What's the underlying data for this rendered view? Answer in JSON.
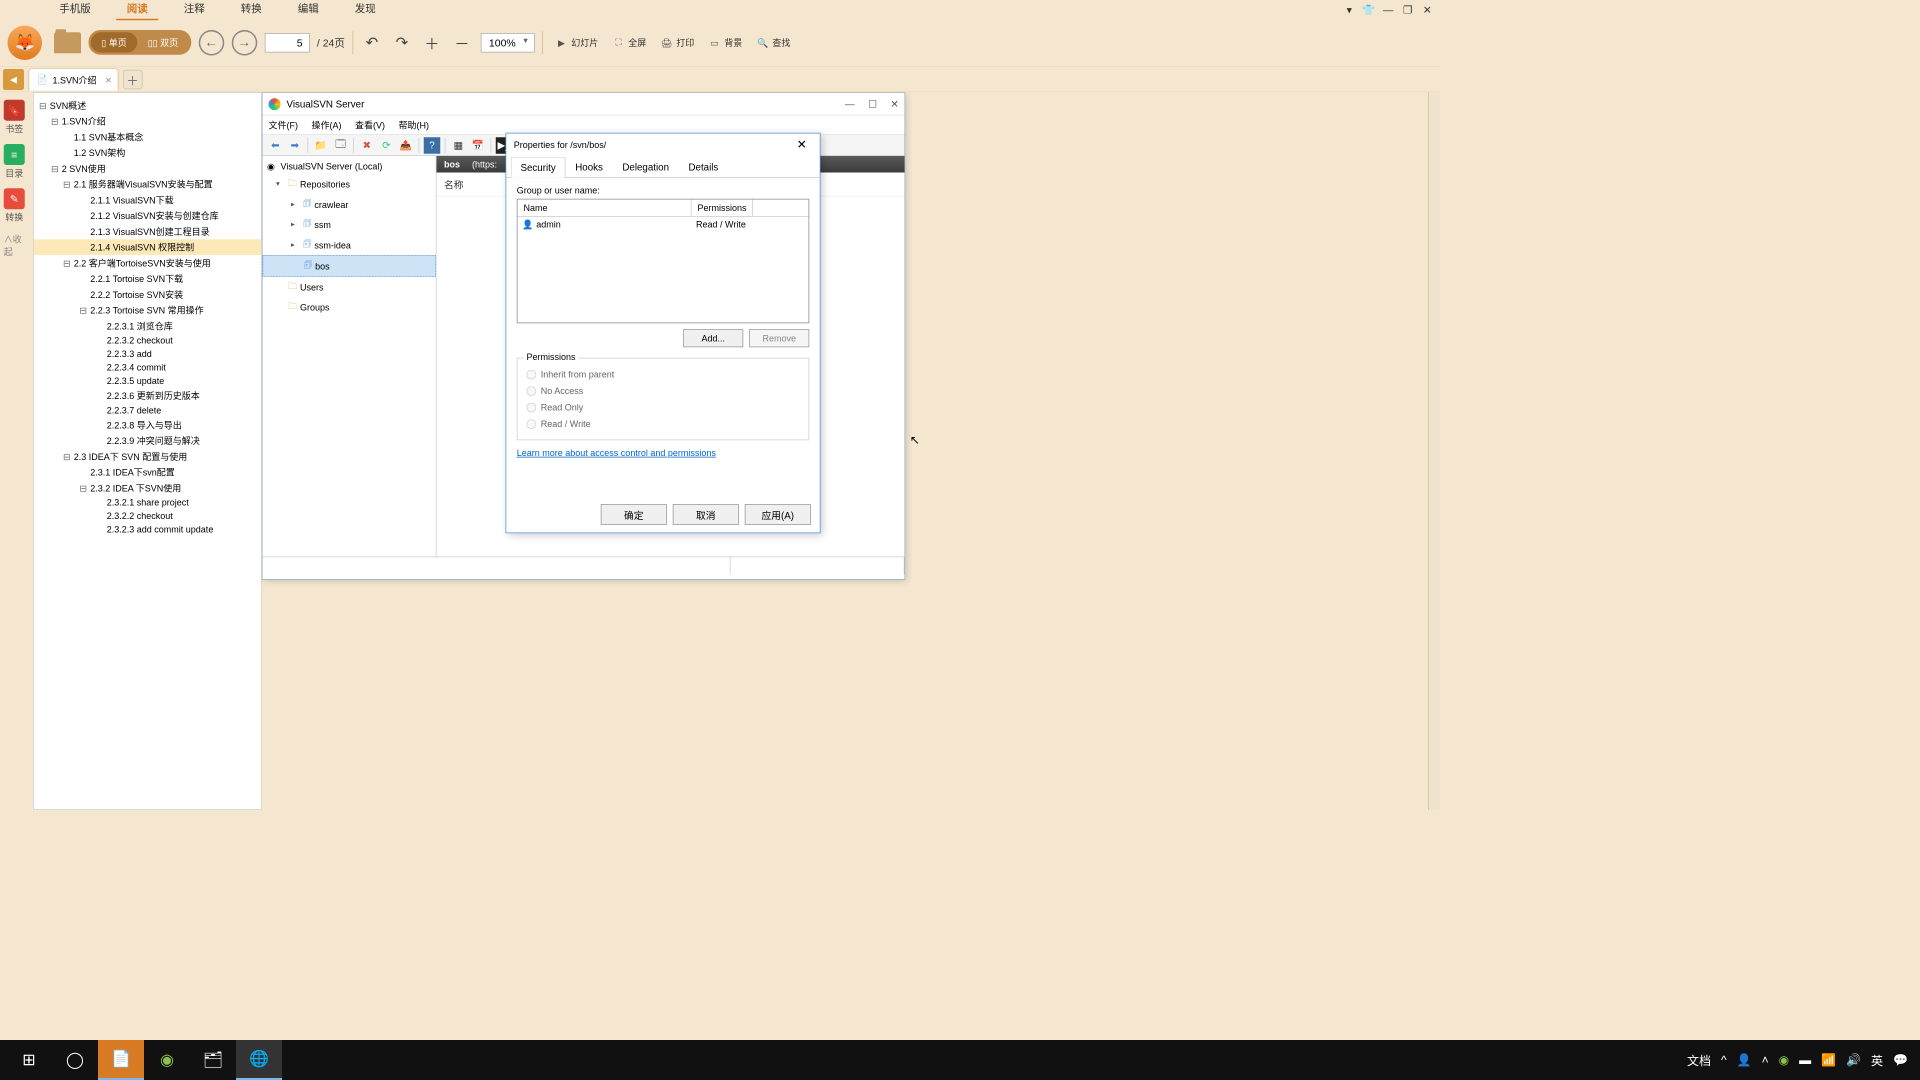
{
  "topTabs": [
    "手机版",
    "阅读",
    "注释",
    "转换",
    "编辑",
    "发现"
  ],
  "activeTopTab": 1,
  "toolbar": {
    "singlePage": "单页",
    "doublePage": "双页",
    "pageCurrent": "5",
    "pageTotal": "/ 24页",
    "zoom": "100%",
    "items": [
      {
        "ic": "▶",
        "t": "幻灯片"
      },
      {
        "ic": "⛶",
        "t": "全屏"
      },
      {
        "ic": "🖨",
        "t": "打印"
      },
      {
        "ic": "▭",
        "t": "背景"
      },
      {
        "ic": "🔍",
        "t": "查找"
      }
    ]
  },
  "docTab": {
    "title": "1.SVN介绍"
  },
  "sidebar": [
    {
      "cls": "red",
      "ic": "🔖",
      "t": "书签"
    },
    {
      "cls": "green",
      "ic": "≡",
      "t": "目录"
    },
    {
      "cls": "blue",
      "ic": "✎",
      "t": "转换"
    }
  ],
  "outline": [
    {
      "i": 0,
      "e": "⊟",
      "t": "SVN概述"
    },
    {
      "i": 1,
      "e": "⊟",
      "t": "1.SVN介绍"
    },
    {
      "i": 2,
      "e": "",
      "t": "1.1 SVN基本概念"
    },
    {
      "i": 2,
      "e": "",
      "t": "1.2 SVN架构"
    },
    {
      "i": 1,
      "e": "⊟",
      "t": "2 SVN使用"
    },
    {
      "i": 2,
      "e": "⊟",
      "t": "2.1 服务器端VisualSVN安装与配置"
    },
    {
      "i": 3,
      "e": "",
      "t": "2.1.1 VisualSVN下载"
    },
    {
      "i": 3,
      "e": "",
      "t": "2.1.2 VisualSVN安装与创建仓库"
    },
    {
      "i": 3,
      "e": "",
      "t": "2.1.3 VisualSVN创建工程目录"
    },
    {
      "i": 3,
      "e": "",
      "t": "2.1.4 VisualSVN 权限控制",
      "hl": true
    },
    {
      "i": 2,
      "e": "⊟",
      "t": "2.2 客户端TortoiseSVN安装与使用"
    },
    {
      "i": 3,
      "e": "",
      "t": "2.2.1 Tortoise SVN下载"
    },
    {
      "i": 3,
      "e": "",
      "t": "2.2.2 Tortoise SVN安装"
    },
    {
      "i": 3,
      "e": "⊟",
      "t": "2.2.3 Tortoise SVN 常用操作"
    },
    {
      "i": 4,
      "e": "",
      "t": "2.2.3.1 浏览仓库"
    },
    {
      "i": 4,
      "e": "",
      "t": "2.2.3.2 checkout"
    },
    {
      "i": 4,
      "e": "",
      "t": "2.2.3.3 add"
    },
    {
      "i": 4,
      "e": "",
      "t": "2.2.3.4 commit"
    },
    {
      "i": 4,
      "e": "",
      "t": "2.2.3.5 update"
    },
    {
      "i": 4,
      "e": "",
      "t": "2.2.3.6 更新到历史版本"
    },
    {
      "i": 4,
      "e": "",
      "t": "2.2.3.7 delete"
    },
    {
      "i": 4,
      "e": "",
      "t": "2.2.3.8 导入与导出"
    },
    {
      "i": 4,
      "e": "",
      "t": "2.2.3.9 冲突问题与解决"
    },
    {
      "i": 2,
      "e": "⊟",
      "t": "2.3 IDEA下 SVN 配置与使用"
    },
    {
      "i": 3,
      "e": "",
      "t": "2.3.1 IDEA下svn配置"
    },
    {
      "i": 3,
      "e": "⊟",
      "t": "2.3.2 IDEA 下SVN使用"
    },
    {
      "i": 4,
      "e": "",
      "t": "2.3.2.1 share project"
    },
    {
      "i": 4,
      "e": "",
      "t": "2.3.2.2 checkout"
    },
    {
      "i": 4,
      "e": "",
      "t": "2.3.2.3 add commit update"
    }
  ],
  "svn": {
    "title": "VisualSVN Server",
    "menu": [
      "文件(F)",
      "操作(A)",
      "查看(V)",
      "帮助(H)"
    ],
    "root": "VisualSVN Server (Local)",
    "repos": "Repositories",
    "repoItems": [
      "crawlear",
      "ssm",
      "ssm-idea",
      "bos"
    ],
    "users": "Users",
    "groups": "Groups",
    "listHead": {
      "name": "bos",
      "url": "(https:"
    },
    "colName": "名称"
  },
  "props": {
    "title": "Properties for /svn/bos/",
    "tabs": [
      "Security",
      "Hooks",
      "Delegation",
      "Details"
    ],
    "groupLabel": "Group or user name:",
    "cols": {
      "name": "Name",
      "perm": "Permissions"
    },
    "row": {
      "name": "admin",
      "perm": "Read / Write"
    },
    "add": "Add...",
    "remove": "Remove",
    "permLegend": "Permissions",
    "perms": [
      "Inherit from parent",
      "No Access",
      "Read Only",
      "Read / Write"
    ],
    "link": "Learn more about access control and permissions",
    "ok": "确定",
    "cancel": "取消",
    "apply": "应用(A)"
  },
  "tray": {
    "text": "文档",
    "ime": "英"
  }
}
